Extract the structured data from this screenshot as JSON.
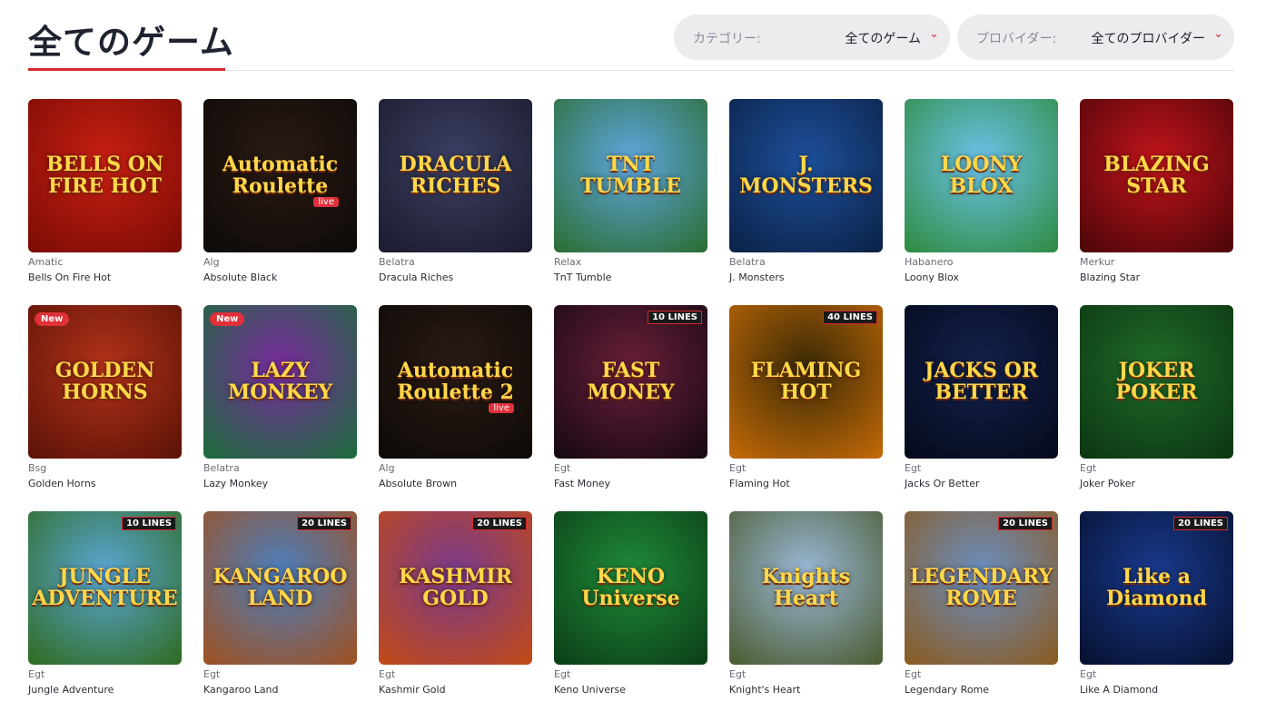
{
  "header": {
    "title": "全てのゲーム",
    "category": {
      "label": "カテゴリー:",
      "value": "全てのゲーム"
    },
    "provider": {
      "label": "プロバイダー:",
      "value": "全てのプロバイダー"
    },
    "accent_color": "#d52a2f"
  },
  "games": [
    {
      "provider": "Amatic",
      "name": "Bells On Fire Hot",
      "art": "BELLS ON FIRE HOT",
      "bg": "#c81f12",
      "bg2": "#7a0c05"
    },
    {
      "provider": "Alg",
      "name": "Absolute Black",
      "art": "Automatic Roulette",
      "badge_live": "live",
      "bg": "#2a1a14",
      "bg2": "#0d0a08"
    },
    {
      "provider": "Belatra",
      "name": "Dracula Riches",
      "art": "DRACULA RICHES",
      "bg": "#3c3f63",
      "bg2": "#1a1b2e"
    },
    {
      "provider": "Relax",
      "name": "TnT Tumble",
      "art": "TNT TUMBLE",
      "bg": "#5ea6e0",
      "bg2": "#2a6c2f"
    },
    {
      "provider": "Belatra",
      "name": "J. Monsters",
      "art": "J. MONSTERS",
      "bg": "#1d4f9a",
      "bg2": "#0b2146"
    },
    {
      "provider": "Habanero",
      "name": "Loony Blox",
      "art": "LOONY BLOX",
      "bg": "#6cc2ea",
      "bg2": "#2d8a3d"
    },
    {
      "provider": "Merkur",
      "name": "Blazing Star",
      "art": "BLAZING STAR",
      "bg": "#c2141c",
      "bg2": "#4a0508"
    },
    {
      "provider": "Bsg",
      "name": "Golden Horns",
      "art": "GOLDEN HORNS",
      "badge_new": "New",
      "bg": "#b3321a",
      "bg2": "#5a1207"
    },
    {
      "provider": "Belatra",
      "name": "Lazy Monkey",
      "art": "LAZY MONKEY",
      "badge_new": "New",
      "bg": "#7a2a9e",
      "bg2": "#1a6d3a"
    },
    {
      "provider": "Alg",
      "name": "Absolute Brown",
      "art": "Automatic Roulette 2",
      "badge_live": "live",
      "bg": "#2a1a14",
      "bg2": "#0d0a08"
    },
    {
      "provider": "Egt",
      "name": "Fast Money",
      "art": "FAST MONEY",
      "badge_lines": "10 LINES",
      "bg": "#6a1f3a",
      "bg2": "#150812"
    },
    {
      "provider": "Egt",
      "name": "Flaming Hot",
      "art": "FLAMING HOT",
      "badge_lines": "40 LINES",
      "bg": "#3a2a06",
      "bg2": "#c56a07"
    },
    {
      "provider": "Egt",
      "name": "Jacks Or Better",
      "art": "JACKS OR BETTER",
      "bg": "#13224d",
      "bg2": "#05091a"
    },
    {
      "provider": "Egt",
      "name": "Joker Poker",
      "art": "JOKER POKER",
      "bg": "#1f6b2a",
      "bg2": "#0c3512"
    },
    {
      "provider": "Egt",
      "name": "Jungle Adventure",
      "art": "JUNGLE ADVENTURE",
      "badge_lines": "10 LINES",
      "bg": "#5aa6d6",
      "bg2": "#2e6a1e"
    },
    {
      "provider": "Egt",
      "name": "Kangaroo Land",
      "art": "KANGAROO LAND",
      "badge_lines": "20 LINES",
      "bg": "#4a7fbf",
      "bg2": "#a0501e"
    },
    {
      "provider": "Egt",
      "name": "Kashmir Gold",
      "art": "KASHMIR GOLD",
      "badge_lines": "20 LINES",
      "bg": "#7a3a8e",
      "bg2": "#c24a14"
    },
    {
      "provider": "Egt",
      "name": "Keno Universe",
      "art": "KENO Universe",
      "bg": "#1f8a3a",
      "bg2": "#0b3d16"
    },
    {
      "provider": "Egt",
      "name": "Knight's Heart",
      "art": "Knights Heart",
      "bg": "#9ab8d8",
      "bg2": "#4a5a2e"
    },
    {
      "provider": "Egt",
      "name": "Legendary Rome",
      "art": "LEGENDARY ROME",
      "badge_lines": "20 LINES",
      "bg": "#6a8ec2",
      "bg2": "#8a5a1e"
    },
    {
      "provider": "Egt",
      "name": "Like A Diamond",
      "art": "Like a Diamond",
      "badge_lines": "20 LINES",
      "bg": "#1a3a8e",
      "bg2": "#06102e"
    }
  ]
}
